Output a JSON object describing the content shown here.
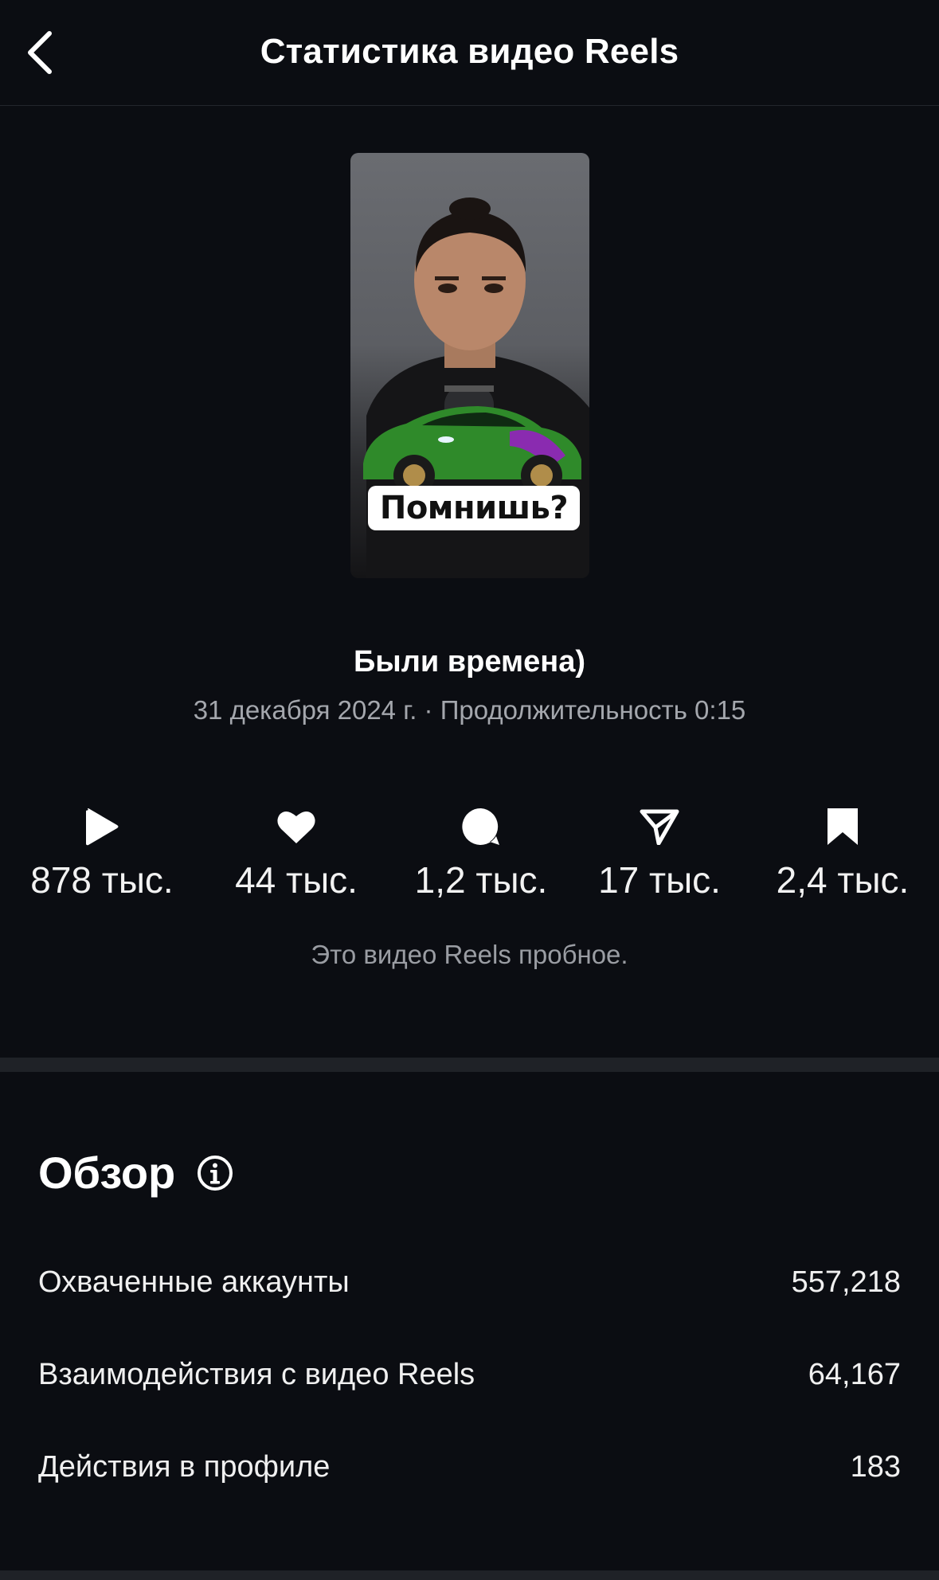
{
  "header": {
    "title": "Статистика видео Reels",
    "back_icon": "chevron-left-icon"
  },
  "thumbnail": {
    "caption": "Помнишь?"
  },
  "video": {
    "title": "Были времена)",
    "meta": "31 декабря 2024 г. · Продолжительность 0:15"
  },
  "stats": [
    {
      "icon": "play-icon",
      "value": "878 тыс."
    },
    {
      "icon": "heart-icon",
      "value": "44 тыс."
    },
    {
      "icon": "comment-icon",
      "value": "1,2 тыс."
    },
    {
      "icon": "share-icon",
      "value": "17 тыс."
    },
    {
      "icon": "bookmark-icon",
      "value": "2,4 тыс."
    }
  ],
  "trial_note": "Это видео Reels пробное.",
  "overview": {
    "title": "Обзор",
    "info_icon": "info-icon",
    "rows": [
      {
        "label": "Охваченные аккаунты",
        "value": "557,218"
      },
      {
        "label": "Взаимодействия с видео Reels",
        "value": "64,167"
      },
      {
        "label": "Действия в профиле",
        "value": "183"
      }
    ]
  },
  "colors": {
    "background": "#0b0d12",
    "text_primary": "#ffffff",
    "text_secondary": "#a4a7ad",
    "divider": "#1f2227"
  }
}
